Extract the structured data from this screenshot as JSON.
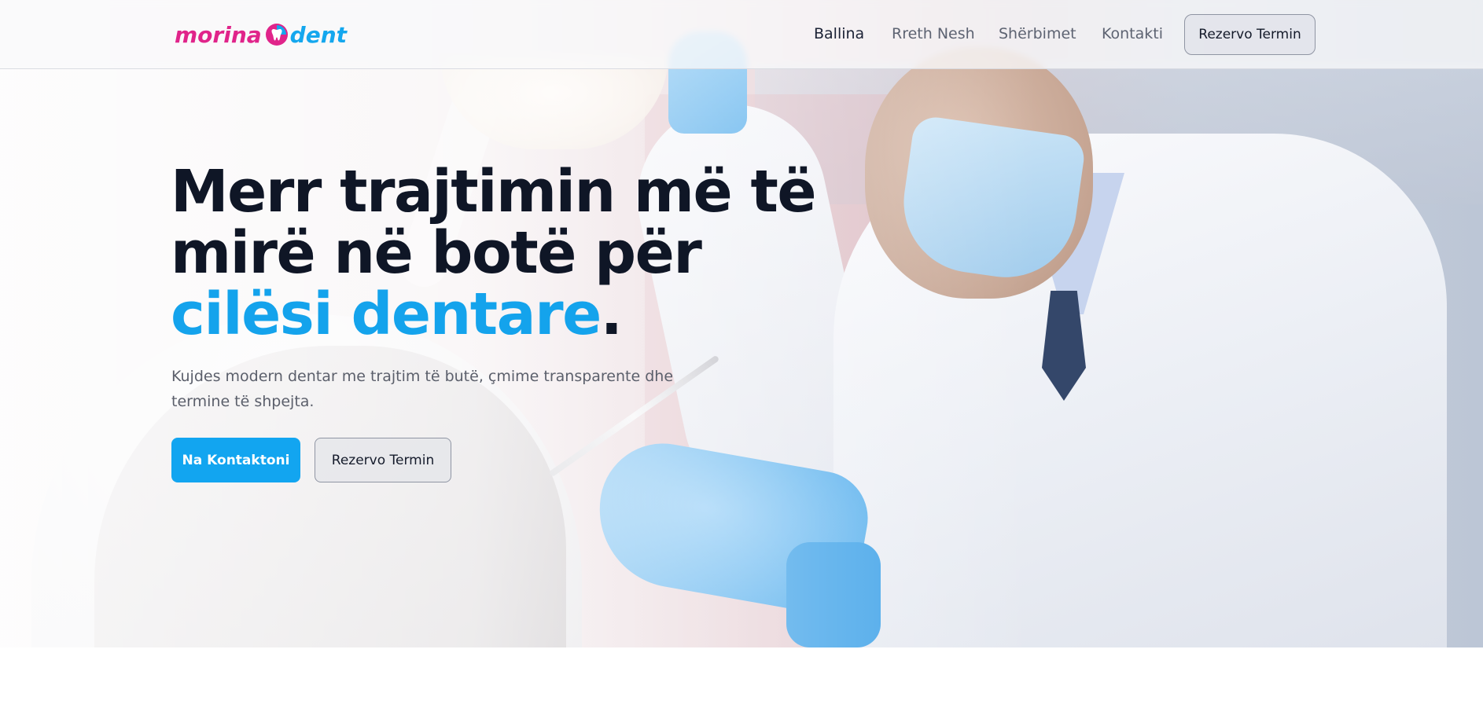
{
  "brand": {
    "logo_part_1": "morina",
    "logo_part_2": "dent",
    "logo_icon": "tooth-icon",
    "colors": {
      "pink": "#e0248a",
      "blue": "#14a7ee"
    }
  },
  "nav": {
    "items": [
      {
        "label": "Ballina",
        "active": true
      },
      {
        "label": "Rreth Nesh",
        "active": false
      },
      {
        "label": "Shërbimet",
        "active": false
      },
      {
        "label": "Kontakti",
        "active": false
      }
    ],
    "cta_label": "Rezervo Termin"
  },
  "hero": {
    "headline_line_1": "Merr trajtimin më të",
    "headline_line_2": "mirë në botë për",
    "headline_accent": "cilësi dentare",
    "headline_period": ".",
    "subtext": "Kujdes modern dentar me trajtim të butë, çmime transparente dhe termine të shpejta.",
    "primary_button": "Na Kontaktoni",
    "secondary_button": "Rezervo Termin",
    "accent_color": "#14a3ec",
    "background_image": "dentist-with-patient-photo"
  }
}
